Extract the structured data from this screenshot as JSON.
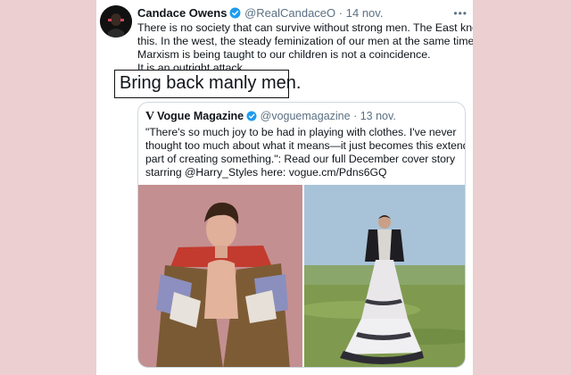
{
  "tweet": {
    "author_name": "Candace Owens",
    "author_handle": "@RealCandaceO",
    "separator": "·",
    "date": "14 nov.",
    "more_label": "•••",
    "text_lines": [
      "There is no society that can survive without strong men. The East knows",
      "this. In the west, the steady feminization of our men at the same time that",
      "Marxism is being taught to our children is not a coincidence.",
      "It is an outright attack."
    ],
    "highlight_text": "Bring back manly men."
  },
  "quoted_tweet": {
    "logo": "V",
    "author_name": "Vogue Magazine",
    "author_handle": "@voguemagazine",
    "separator": "·",
    "date": "13 nov.",
    "text_lines": [
      "\"There's so much joy to be had in playing with clothes. I've never",
      "thought too much about what it means—it just becomes this extended",
      "part of creating something.\": Read our full December cover story",
      "starring @Harry_Styles here: vogue.cm/Pdns6GQ"
    ]
  },
  "icons": {
    "verified": "verified-badge-icon",
    "more": "more-options-icon"
  },
  "colors": {
    "background": "#ebcfd1",
    "verified_blue": "#1d9bf0",
    "secondary_text": "#5b7083"
  }
}
